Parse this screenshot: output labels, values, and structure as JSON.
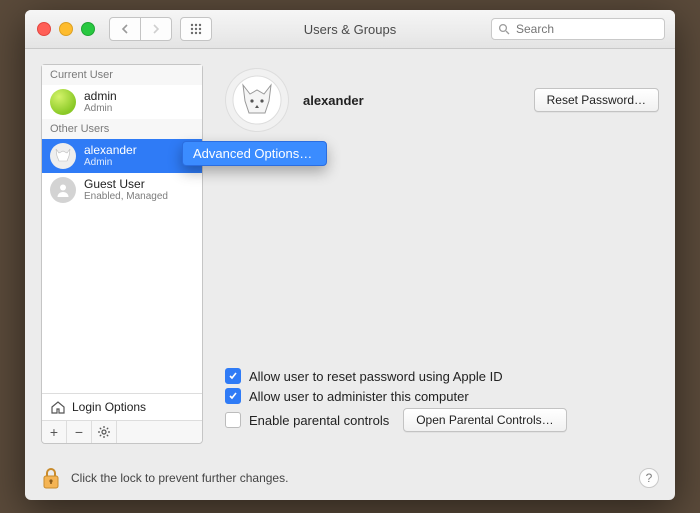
{
  "window": {
    "title": "Users & Groups"
  },
  "search": {
    "placeholder": "Search"
  },
  "sidebar": {
    "current_header": "Current User",
    "other_header": "Other Users",
    "current": {
      "name": "admin",
      "role": "Admin"
    },
    "others": [
      {
        "name": "alexander",
        "role": "Admin"
      },
      {
        "name": "Guest User",
        "role": "Enabled, Managed"
      }
    ],
    "login_options": "Login Options",
    "buttons": {
      "add": "+",
      "remove": "−",
      "gear": "✱"
    }
  },
  "context_menu": {
    "item": "Advanced Options…"
  },
  "main": {
    "username": "alexander",
    "reset_password": "Reset Password…",
    "checks": {
      "reset_apple_id": "Allow user to reset password using Apple ID",
      "administer": "Allow user to administer this computer",
      "parental": "Enable parental controls"
    },
    "open_parental": "Open Parental Controls…"
  },
  "lock": {
    "text": "Click the lock to prevent further changes.",
    "help": "?"
  }
}
